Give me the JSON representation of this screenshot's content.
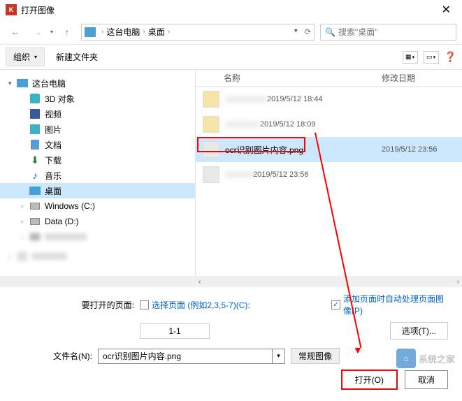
{
  "title": "打开图像",
  "nav": {
    "breadcrumb": [
      "这台电脑",
      "桌面"
    ],
    "search_placeholder": "搜索\"桌面\""
  },
  "toolbar": {
    "organize": "组织",
    "new_folder": "新建文件夹"
  },
  "sidebar": {
    "items": [
      {
        "label": "这台电脑",
        "icon": "pc",
        "indent": 0,
        "expanded": true
      },
      {
        "label": "3D 对象",
        "icon": "3d",
        "indent": 1
      },
      {
        "label": "视频",
        "icon": "video",
        "indent": 1
      },
      {
        "label": "图片",
        "icon": "pic",
        "indent": 1
      },
      {
        "label": "文档",
        "icon": "doc",
        "indent": 1
      },
      {
        "label": "下载",
        "icon": "dl",
        "indent": 1
      },
      {
        "label": "音乐",
        "icon": "music",
        "indent": 1
      },
      {
        "label": "桌面",
        "icon": "desktop",
        "indent": 1,
        "selected": true
      },
      {
        "label": "Windows (C:)",
        "icon": "drive",
        "indent": 1
      },
      {
        "label": "Data (D:)",
        "icon": "drive",
        "indent": 1
      },
      {
        "label": "",
        "icon": "blur",
        "indent": 1
      },
      {
        "label": "",
        "icon": "blur",
        "indent": 0
      }
    ]
  },
  "filelist": {
    "col_name": "名称",
    "col_date": "修改日期",
    "rows": [
      {
        "name": "",
        "date": "2019/5/12 18:44",
        "thumb": "folder"
      },
      {
        "name": "",
        "date": "2019/5/12 18:09",
        "thumb": "folder"
      },
      {
        "name": "ocr识别图片内容.png",
        "date": "2019/5/12 23:56",
        "thumb": "img",
        "selected": true,
        "highlighted": true
      },
      {
        "name": "",
        "date": "2019/5/12 23:56",
        "thumb": "img"
      }
    ]
  },
  "footer": {
    "pages_label": "要打开的页面:",
    "select_pages": "选择页面",
    "pages_hint": "(例如2,3,5-7)(C):",
    "page_range": "1-1",
    "auto_process": "添加页面时自动处理页面图像(P)",
    "options": "选项(T)...",
    "filename_label": "文件名(N):",
    "filename_value": "ocr识别图片内容.png",
    "filetype": "常规图像",
    "open": "打开(O)",
    "cancel": "取消"
  },
  "watermark": "系统之家"
}
